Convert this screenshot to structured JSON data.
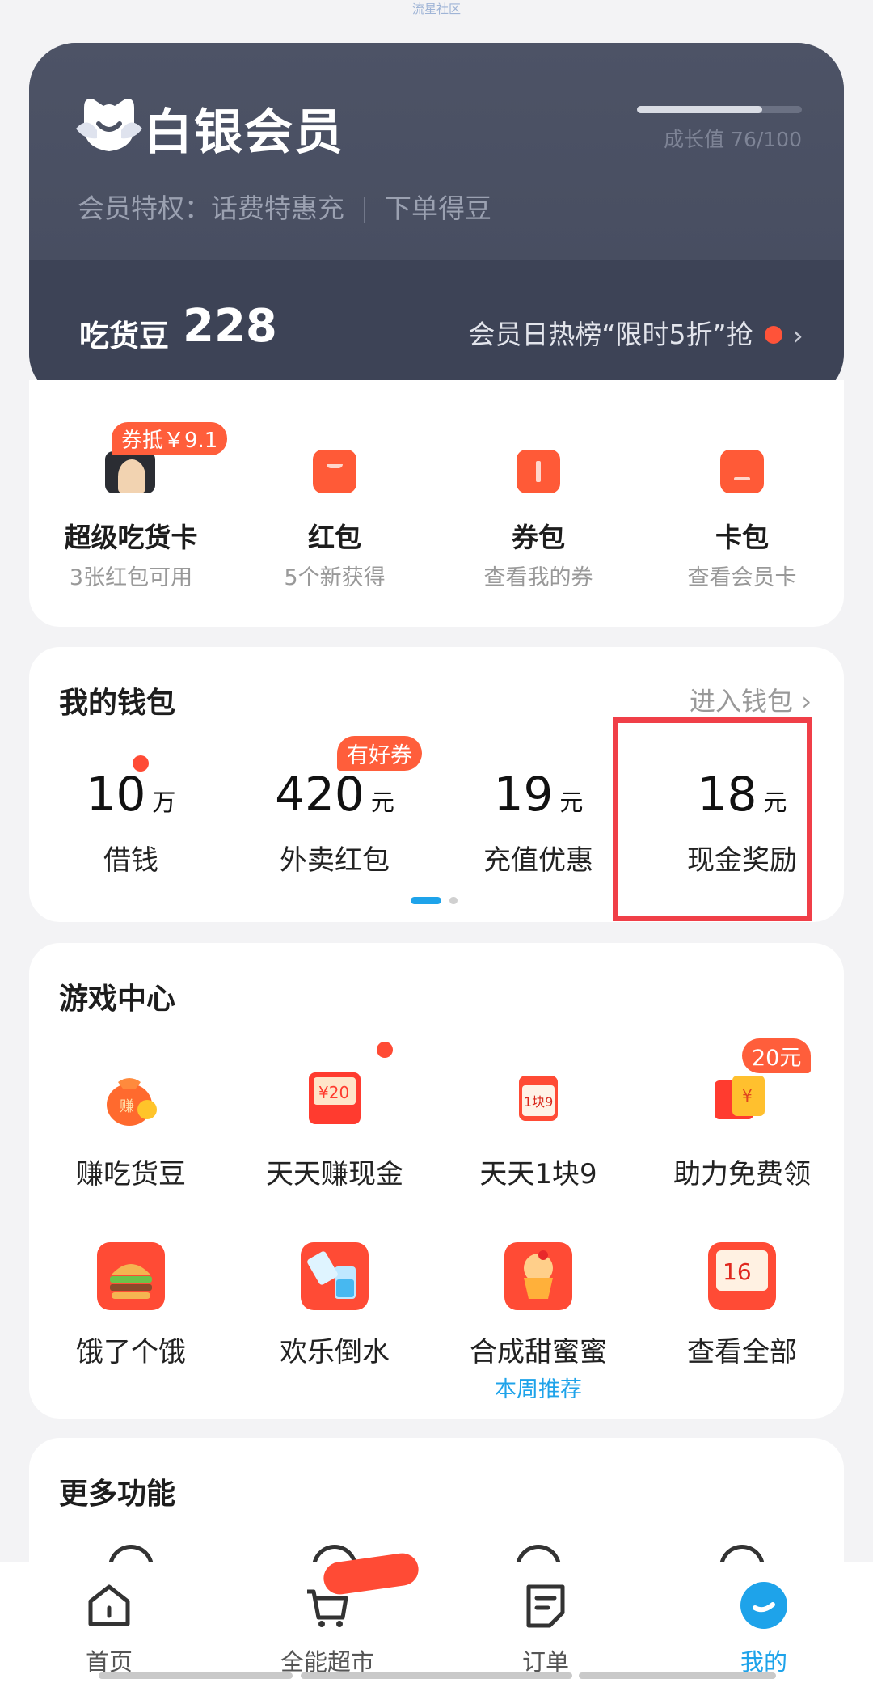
{
  "watermark": "流星社区",
  "member": {
    "title": "白银会员",
    "growth_label": "成长值 76/100",
    "growth_fraction": 0.76,
    "privileges_prefix": "会员特权：",
    "privilege_1": "话费特惠充",
    "privilege_2": "下单得豆",
    "beans_label": "吃货豆",
    "beans_value": "228",
    "promo_text": "会员日热榜“限时5折”抢"
  },
  "quick_actions": [
    {
      "label": "超级吃货卡",
      "sub": "3张红包可用",
      "badge": "券抵￥9.1",
      "icon": "avatar-icon"
    },
    {
      "label": "红包",
      "sub": "5个新获得",
      "icon": "red-packet-icon"
    },
    {
      "label": "券包",
      "sub": "查看我的券",
      "icon": "coupon-icon"
    },
    {
      "label": "卡包",
      "sub": "查看会员卡",
      "icon": "card-icon"
    }
  ],
  "wallet": {
    "title": "我的钱包",
    "link": "进入钱包 ›",
    "items": [
      {
        "value": "10",
        "unit": "万",
        "label": "借钱"
      },
      {
        "value": "420",
        "unit": "元",
        "label": "外卖红包",
        "badge": "有好券"
      },
      {
        "value": "19",
        "unit": "元",
        "label": "充值优惠"
      },
      {
        "value": "18",
        "unit": "元",
        "label": "现金奖励"
      }
    ]
  },
  "games": {
    "title": "游戏中心",
    "badge": "20元",
    "items": [
      {
        "label": "赚吃货豆",
        "icon": "money-bag-icon"
      },
      {
        "label": "天天赚现金",
        "icon": "envelope-20-icon"
      },
      {
        "label": "天天1块9",
        "icon": "calendar-icon"
      },
      {
        "label": "助力免费领",
        "icon": "gift-ticket-icon"
      },
      {
        "label": "饿了个饿",
        "icon": "burger-icon"
      },
      {
        "label": "欢乐倒水",
        "icon": "water-cup-icon"
      },
      {
        "label": "合成甜蜜蜜",
        "sub": "本周推荐",
        "icon": "cupcake-icon"
      },
      {
        "label": "查看全部",
        "icon": "coupon-16-icon"
      }
    ]
  },
  "more": {
    "title": "更多功能"
  },
  "nav": [
    {
      "label": "首页",
      "icon": "home-icon"
    },
    {
      "label": "全能超市",
      "icon": "cart-icon"
    },
    {
      "label": "订单",
      "icon": "order-icon"
    },
    {
      "label": "我的",
      "icon": "profile-icon"
    }
  ],
  "colors": {
    "accent": "#1ea3ea",
    "red": "#ff5339",
    "card_dark": "#3d4356"
  }
}
